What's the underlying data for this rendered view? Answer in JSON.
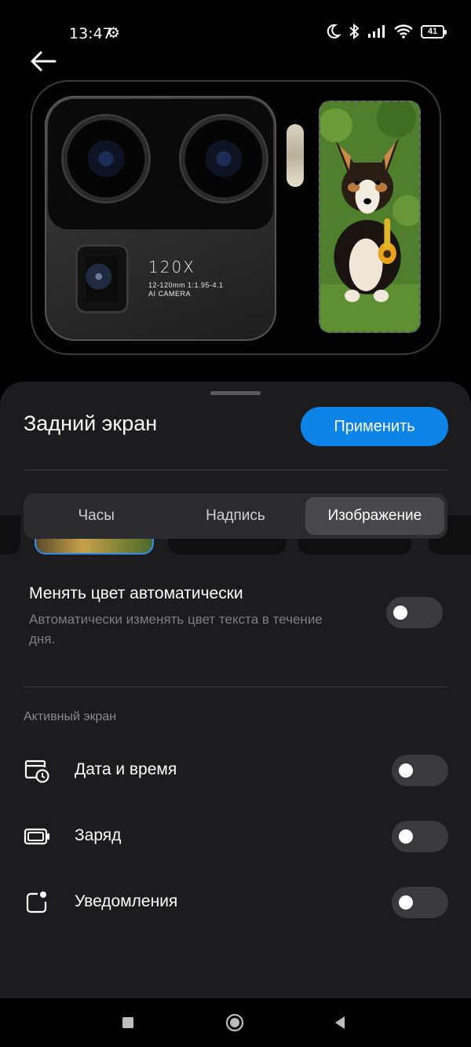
{
  "status_bar": {
    "time": "13:47",
    "battery": "41",
    "icons": [
      "settings-icon",
      "moon-icon",
      "bluetooth-icon",
      "signal-icon",
      "wifi-icon",
      "battery-icon"
    ]
  },
  "preview": {
    "camera_model": "120X",
    "camera_spec_line1": "12-120mm 1:1.95-4.1",
    "camera_spec_line2": "AI CAMERA"
  },
  "sheet": {
    "title": "Задний экран",
    "apply_label": "Применить",
    "tabs": [
      {
        "label": "Часы",
        "active": false
      },
      {
        "label": "Надпись",
        "active": false
      },
      {
        "label": "Изображение",
        "active": true
      }
    ],
    "auto_color": {
      "title": "Менять цвет автоматически",
      "description": "Автоматически изменять цвет текста в течение дня.",
      "enabled": false
    },
    "section_label": "Активный экран",
    "settings": [
      {
        "label": "Дата и время",
        "icon": "calendar-clock-icon",
        "enabled": false
      },
      {
        "label": "Заряд",
        "icon": "battery-outline-icon",
        "enabled": false
      },
      {
        "label": "Уведомления",
        "icon": "notification-dot-icon",
        "enabled": false
      }
    ]
  },
  "colors": {
    "accent": "#0d84e8",
    "sheet_bg": "#1c1c1e",
    "toggle_off": "#3a3a3c"
  }
}
